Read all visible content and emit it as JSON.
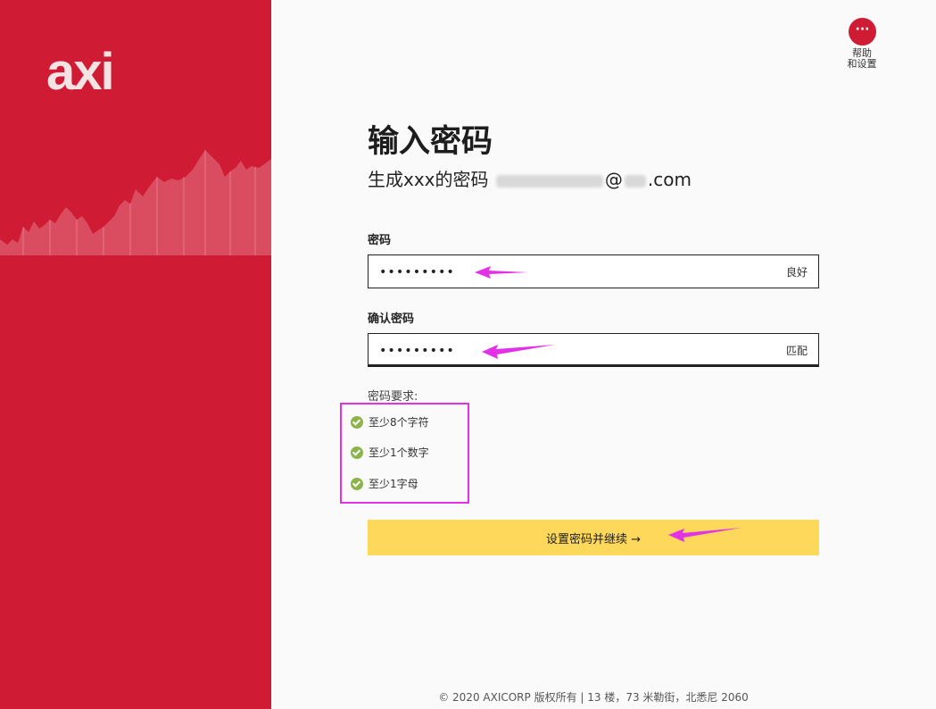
{
  "brand": {
    "logo_text": "axi"
  },
  "help": {
    "icon_text": "···",
    "label_line1": "帮助",
    "label_line2": "和设置"
  },
  "header": {
    "title": "输入密码",
    "subtitle_prefix": "生成xxx的密码",
    "email_at": "@",
    "email_suffix": ".com"
  },
  "password": {
    "label": "密码",
    "value": "•••••••••",
    "strength": "良好"
  },
  "confirm": {
    "label": "确认密码",
    "value": "•••••••••",
    "status": "匹配"
  },
  "requirements": {
    "title": "密码要求:",
    "items": [
      "至少8个字符",
      "至少1个数字",
      "至少1字母"
    ]
  },
  "submit": {
    "label": "设置密码并继续 →"
  },
  "footer": {
    "text": "© 2020 AXICORP 版权所有 | 13 楼，73 米勒街，北悉尼 2060"
  },
  "colors": {
    "brand_red": "#d01b35",
    "button_yellow": "#fdd85a",
    "check_green": "#8cb44b",
    "annotation_magenta": "#e331e8"
  }
}
